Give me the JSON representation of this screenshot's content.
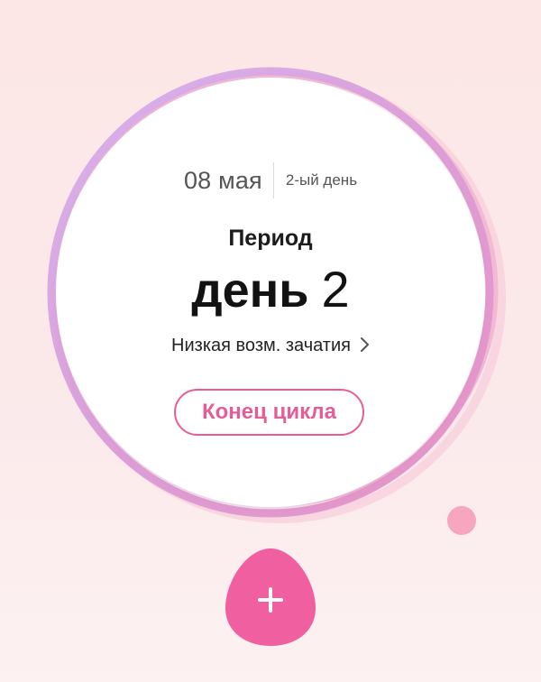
{
  "cycle_card": {
    "date": "08 мая",
    "day_of_cycle": "2-ый день",
    "phase": "Период",
    "big_day_word": "день",
    "big_day_number": "2",
    "fertility": "Низкая возм. зачатия",
    "end_cycle_label": "Конец цикла"
  },
  "colors": {
    "ring_purple": "#d2b1ec",
    "ring_pink": "#ea9ccc",
    "accent_pink": "#f05fa0",
    "button_text": "#e45d97",
    "dot": "#f6a6bf"
  },
  "icons": {
    "fertility_chevron": "chevron-right-icon",
    "add_button_icon": "plus-icon"
  }
}
